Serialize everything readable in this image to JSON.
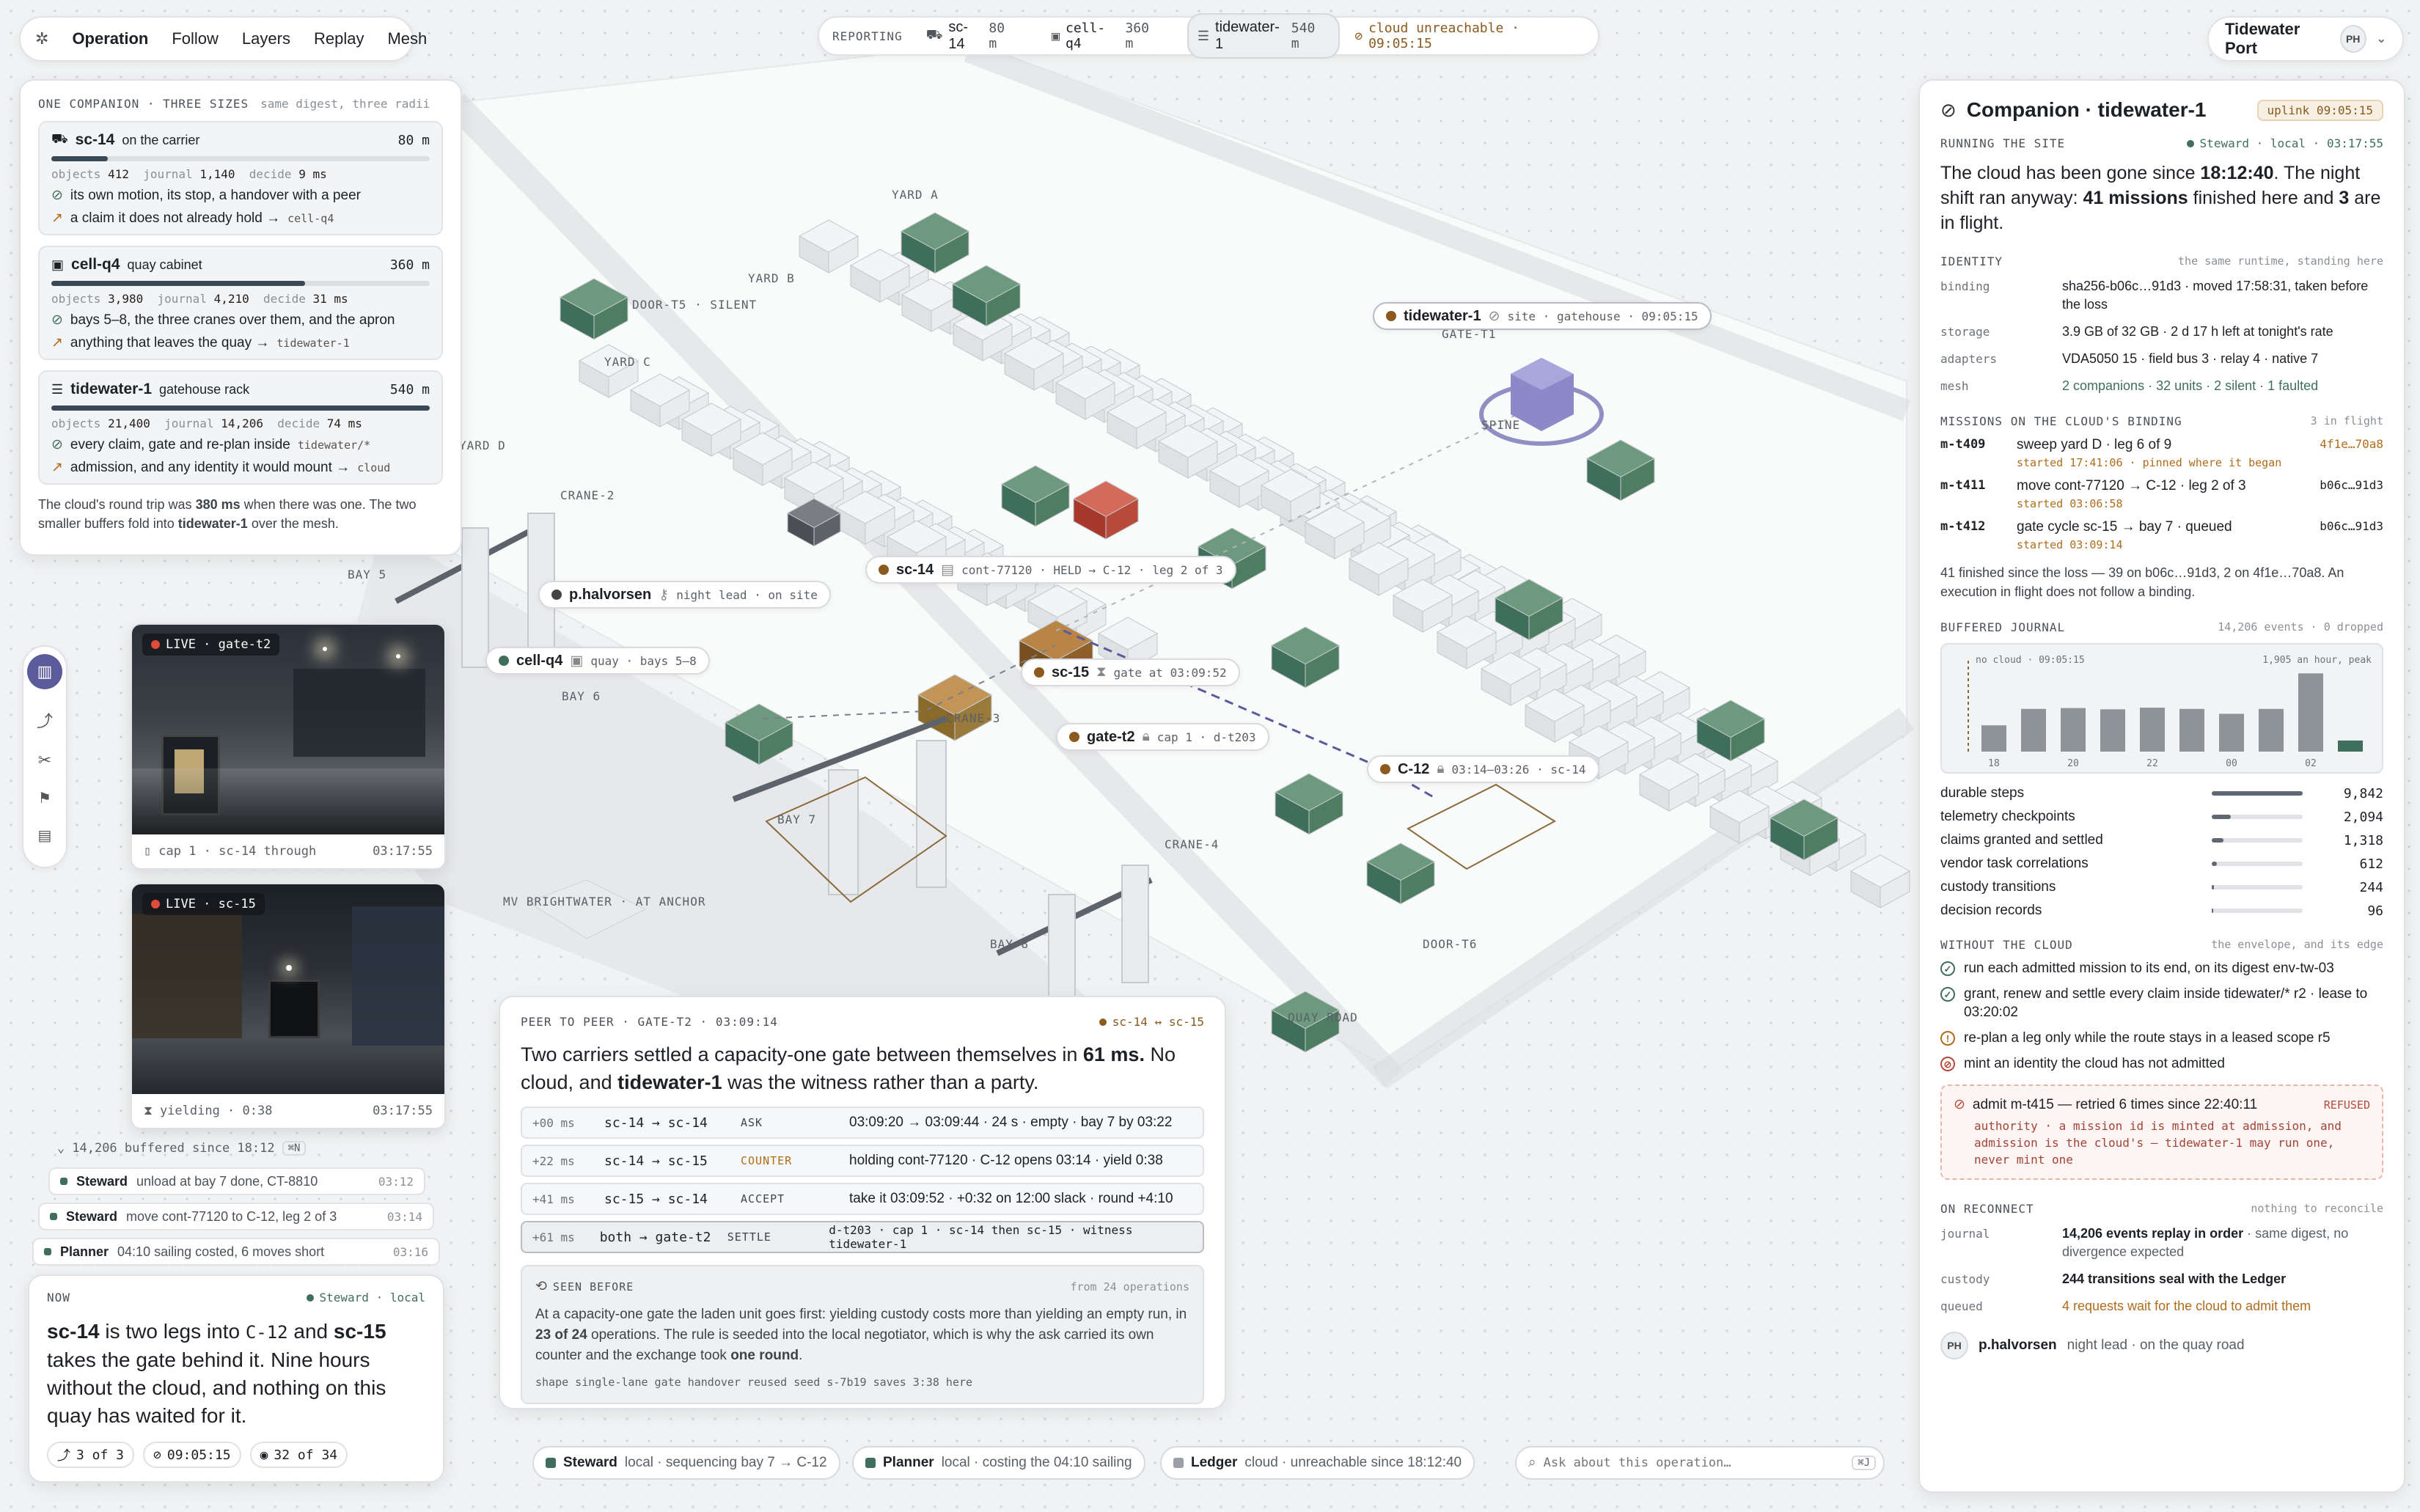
{
  "nav": {
    "items": [
      "Operation",
      "Follow",
      "Layers",
      "Replay",
      "Mesh"
    ]
  },
  "reporting": {
    "label": "REPORTING",
    "units": [
      {
        "name": "sc-14",
        "range": "80 m"
      },
      {
        "name": "cell-q4",
        "range": "360 m"
      },
      {
        "name": "tidewater-1",
        "range": "540 m"
      }
    ],
    "cloud": "cloud unreachable · 09:05:15"
  },
  "site": {
    "name": "Tidewater Port",
    "avatar": "PH"
  },
  "sizes": {
    "title": "ONE COMPANION · THREE SIZES",
    "subtitle": "same digest, three radii",
    "cards": [
      {
        "name": "sc-14",
        "where": "on the carrier",
        "radius": "80 m",
        "fill": 0.15,
        "objects": "412",
        "journal": "1,140",
        "decide": "9 ms",
        "line1": "its own motion, its stop, a handover with a peer",
        "line2a": "a claim it does not already hold →",
        "line2b": "cell-q4"
      },
      {
        "name": "cell-q4",
        "where": "quay cabinet",
        "radius": "360 m",
        "fill": 0.67,
        "objects": "3,980",
        "journal": "4,210",
        "decide": "31 ms",
        "line1": "bays 5–8, the three cranes over them, and the apron",
        "line2a": "anything that leaves the quay →",
        "line2b": "tidewater-1"
      },
      {
        "name": "tidewater-1",
        "where": "gatehouse rack",
        "radius": "540 m",
        "fill": 1.0,
        "objects": "21,400",
        "journal": "14,206",
        "decide": "74 ms",
        "line1a": "every claim, gate and re-plan inside",
        "line1b": "tidewater/*",
        "line2a": "admission, and any identity it would mount →",
        "line2b": "cloud"
      }
    ],
    "k_objects": "objects",
    "k_journal": "journal",
    "k_decide": "decide",
    "footer_a": "The cloud's round trip was",
    "footer_b": "380 ms",
    "footer_c": "when there was one. The two smaller buffers fold into",
    "footer_d": "tidewater-1",
    "footer_e": "over the mesh."
  },
  "cams": [
    {
      "live": "LIVE · gate-t2",
      "caption": "cap 1 · sc-14 through",
      "time": "03:17:55"
    },
    {
      "live": "LIVE · sc-15",
      "caption": "yielding · 0:38",
      "time": "03:17:55"
    }
  ],
  "buffered": {
    "text": "14,206 buffered since 18:12",
    "key": "⌘N"
  },
  "feed": [
    {
      "who": "Steward",
      "what": "unload at bay 7 done, CT-8810",
      "time": "03:12"
    },
    {
      "who": "Steward",
      "what": "move cont-77120 to C-12, leg 2 of 3",
      "time": "03:14"
    },
    {
      "who": "Planner",
      "what": "04:10 sailing costed, 6 moves short",
      "time": "03:16"
    }
  ],
  "now": {
    "label": "NOW",
    "agent": "Steward · local",
    "t1": "sc-14",
    "t2": " is two legs into ",
    "t3": "C-12",
    "t4": " and ",
    "t5": "sc-15",
    "t6": " takes the gate behind it. Nine hours without the cloud, and nothing on this quay has waited for it.",
    "tags": [
      "3 of 3",
      "09:05:15",
      "32 of 34"
    ]
  },
  "peer": {
    "label": "PEER TO PEER · GATE-T2 · 03:09:14",
    "pair": "sc-14 ↔ sc-15",
    "h1": "Two carriers settled a capacity-one gate between themselves in ",
    "h2": "61 ms.",
    "h3": " No cloud, and ",
    "h4": "tidewater-1",
    "h5": " was the witness rather than a party.",
    "rows": [
      {
        "t": "+00 ms",
        "who": "sc-14 → sc-14",
        "kind": "ASK",
        "detail": "03:09:20 → 03:09:44 · 24 s · empty · bay 7 by 03:22"
      },
      {
        "t": "+22 ms",
        "who": "sc-14 → sc-15",
        "kind": "COUNTER",
        "detail": "holding cont-77120 · C-12 opens 03:14 · yield 0:38"
      },
      {
        "t": "+41 ms",
        "who": "sc-15 → sc-14",
        "kind": "ACCEPT",
        "detail": "take it 03:09:52 · +0:32 on 12:00 slack · round +4:10"
      },
      {
        "t": "+61 ms",
        "who": "both → gate-t2",
        "kind": "SETTLE",
        "detail": "d-t203 · cap 1 · sc-14 then sc-15 · witness tidewater-1"
      }
    ],
    "seen_label": "SEEN BEFORE",
    "seen_from": "from 24 operations",
    "seen_a": "At a capacity-one gate the laden unit goes first: yielding custody costs more than yielding an empty run, in ",
    "seen_b": "23 of 24",
    "seen_c": " operations. The rule is seeded into the local negotiator, which is why the ask carried its own counter and the exchange took ",
    "seen_d": "one round",
    "seen_e": ".",
    "shape": "shape single-lane gate handover  reused seed s-7b19  saves 3:38 here"
  },
  "bottom": [
    {
      "name": "Steward",
      "text": "local · sequencing bay 7 → C-12",
      "color": "#3f6f5c"
    },
    {
      "name": "Planner",
      "text": "local · costing the 04:10 sailing",
      "color": "#3f6f5c"
    },
    {
      "name": "Ledger",
      "text": "cloud · unreachable since 18:12:40",
      "color": "#9aa0a6"
    }
  ],
  "ask": {
    "placeholder": "Ask about this operation…",
    "key": "⌘J"
  },
  "map": {
    "zones": [
      "YARD A",
      "YARD B",
      "YARD C",
      "YARD D",
      "DOOR-T5 · SILENT",
      "CRANE-2",
      "BAY 5",
      "BAY 6",
      "CRANE-3",
      "BAY 7",
      "CRANE-4",
      "BAY 8",
      "MV BRIGHTWATER · AT ANCHOR",
      "DOOR-T6",
      "QUAY ROAD",
      "SPINE",
      "GATE-T1"
    ],
    "labels": {
      "tidewater": {
        "name": "tidewater-1",
        "meta": "site · gatehouse · 09:05:15"
      },
      "sc14": {
        "name": "sc-14",
        "meta": "cont-77120 · HELD → C-12 · leg 2 of 3"
      },
      "halvorsen": {
        "name": "p.halvorsen",
        "meta": "night lead · on site"
      },
      "cellq4": {
        "name": "cell-q4",
        "meta": "quay · bays 5–8"
      },
      "sc15": {
        "name": "sc-15",
        "meta": "gate at 03:09:52"
      },
      "gatet2": {
        "name": "gate-t2",
        "meta": "cap 1 · d-t203"
      },
      "c12": {
        "name": "C-12",
        "meta": "03:14–03:26 · sc-14"
      }
    }
  },
  "right": {
    "title": "Companion · tidewater-1",
    "uplink": "uplink 09:05:15",
    "running": "RUNNING THE SITE",
    "agent": "Steward · local · 03:17:55",
    "lead_a": "The cloud has been gone since ",
    "lead_b": "18:12:40",
    "lead_c": ". The night shift ran anyway: ",
    "lead_d": "41 missions",
    "lead_e": " finished here and ",
    "lead_f": "3",
    "lead_g": " are in flight.",
    "identity": "IDENTITY",
    "identity_sub": "the same runtime, standing here",
    "kv": [
      {
        "k": "binding",
        "v": "sha256-b06c…91d3 · moved 17:58:31, taken before the loss"
      },
      {
        "k": "storage",
        "v": "3.9 GB of 32 GB · 2 d 17 h left at tonight's rate"
      },
      {
        "k": "adapters",
        "v": "VDA5050 15 · field bus 3 · relay 4 · native 7"
      },
      {
        "k": "mesh",
        "v": "2 companions · 32 units · 2 silent · 1 faulted"
      }
    ],
    "missions_label": "MISSIONS ON THE CLOUD'S BINDING",
    "missions_sub": "3 in flight",
    "missions": [
      {
        "id": "m-t409",
        "what": "sweep yard D · leg 6 of 9",
        "hash": "4f1e…70a8",
        "started": "started 17:41:06 · pinned where it began"
      },
      {
        "id": "m-t411",
        "what": "move cont-77120 → C-12 · leg 2 of 3",
        "hash": "b06c…91d3",
        "started": "started 03:06:58"
      },
      {
        "id": "m-t412",
        "what": "gate cycle sc-15 → bay 7 · queued",
        "hash": "b06c…91d3",
        "started": "started 03:09:14"
      }
    ],
    "finished": "41 finished since the loss — 39 on b06c…91d3, 2 on 4f1e…70a8. An execution in flight does not follow a binding.",
    "journal_label": "BUFFERED JOURNAL",
    "journal_sub": "14,206 events · 0 dropped",
    "chart_note_a": "no cloud · 09:05:15",
    "chart_note_b": "1,905 an hour, peak",
    "counts": [
      {
        "k": "durable steps",
        "v": "9,842",
        "f": 1.0
      },
      {
        "k": "telemetry checkpoints",
        "v": "2,094",
        "f": 0.21
      },
      {
        "k": "claims granted and settled",
        "v": "1,318",
        "f": 0.13
      },
      {
        "k": "vendor task correlations",
        "v": "612",
        "f": 0.06
      },
      {
        "k": "custody transitions",
        "v": "244",
        "f": 0.025
      },
      {
        "k": "decision records",
        "v": "96",
        "f": 0.01
      }
    ],
    "without_label": "WITHOUT THE CLOUD",
    "without_sub": "the envelope, and its edge",
    "rules": [
      {
        "kind": "ok",
        "text": "run each admitted mission to its end, on its digest env-tw-03"
      },
      {
        "kind": "ok",
        "text": "grant, renew and settle every claim inside tidewater/* r2 · lease to 03:20:02"
      },
      {
        "kind": "warn",
        "text": "re-plan a leg only while the route stays in a leased scope r5"
      },
      {
        "kind": "no",
        "text": "mint an identity the cloud has not admitted"
      }
    ],
    "refused_a": "admit m-t415 — retried 6 times since 22:40:11",
    "refused_b": "REFUSED",
    "refused_msg": "authority · a mission id is minted at admission, and admission is the cloud's — tidewater-1 may run one, never mint one",
    "reconnect_label": "ON RECONNECT",
    "reconnect_sub": "nothing to reconcile",
    "reconnect": [
      {
        "k": "journal",
        "a": "14,206 events replay in order",
        "b": " · same digest, no divergence expected"
      },
      {
        "k": "custody",
        "a": "244 transitions seal with the Ledger",
        "b": ""
      },
      {
        "k": "queued",
        "a": "4 requests wait for the cloud to admit them",
        "b": ""
      }
    ],
    "person": {
      "avatar": "PH",
      "name": "p.halvorsen",
      "role": "night lead · on the quay road"
    }
  },
  "chart_data": {
    "type": "bar",
    "categories": [
      "18",
      "19",
      "20",
      "21",
      "22",
      "23",
      "00",
      "01",
      "02",
      "03"
    ],
    "x_ticks": [
      "18",
      "20",
      "22",
      "00",
      "02"
    ],
    "values": [
      640,
      1040,
      1060,
      1030,
      1070,
      1040,
      920,
      1040,
      1905,
      270
    ],
    "annotation": "1,905 an hour, peak",
    "marker": "no cloud · 09:05:15",
    "grid": false
  },
  "colors": {
    "accent": "#5b5b9c",
    "ok": "#3f6f5c",
    "warn": "#b06c1c",
    "error": "#b84a3a",
    "container": "#4e7d62"
  }
}
